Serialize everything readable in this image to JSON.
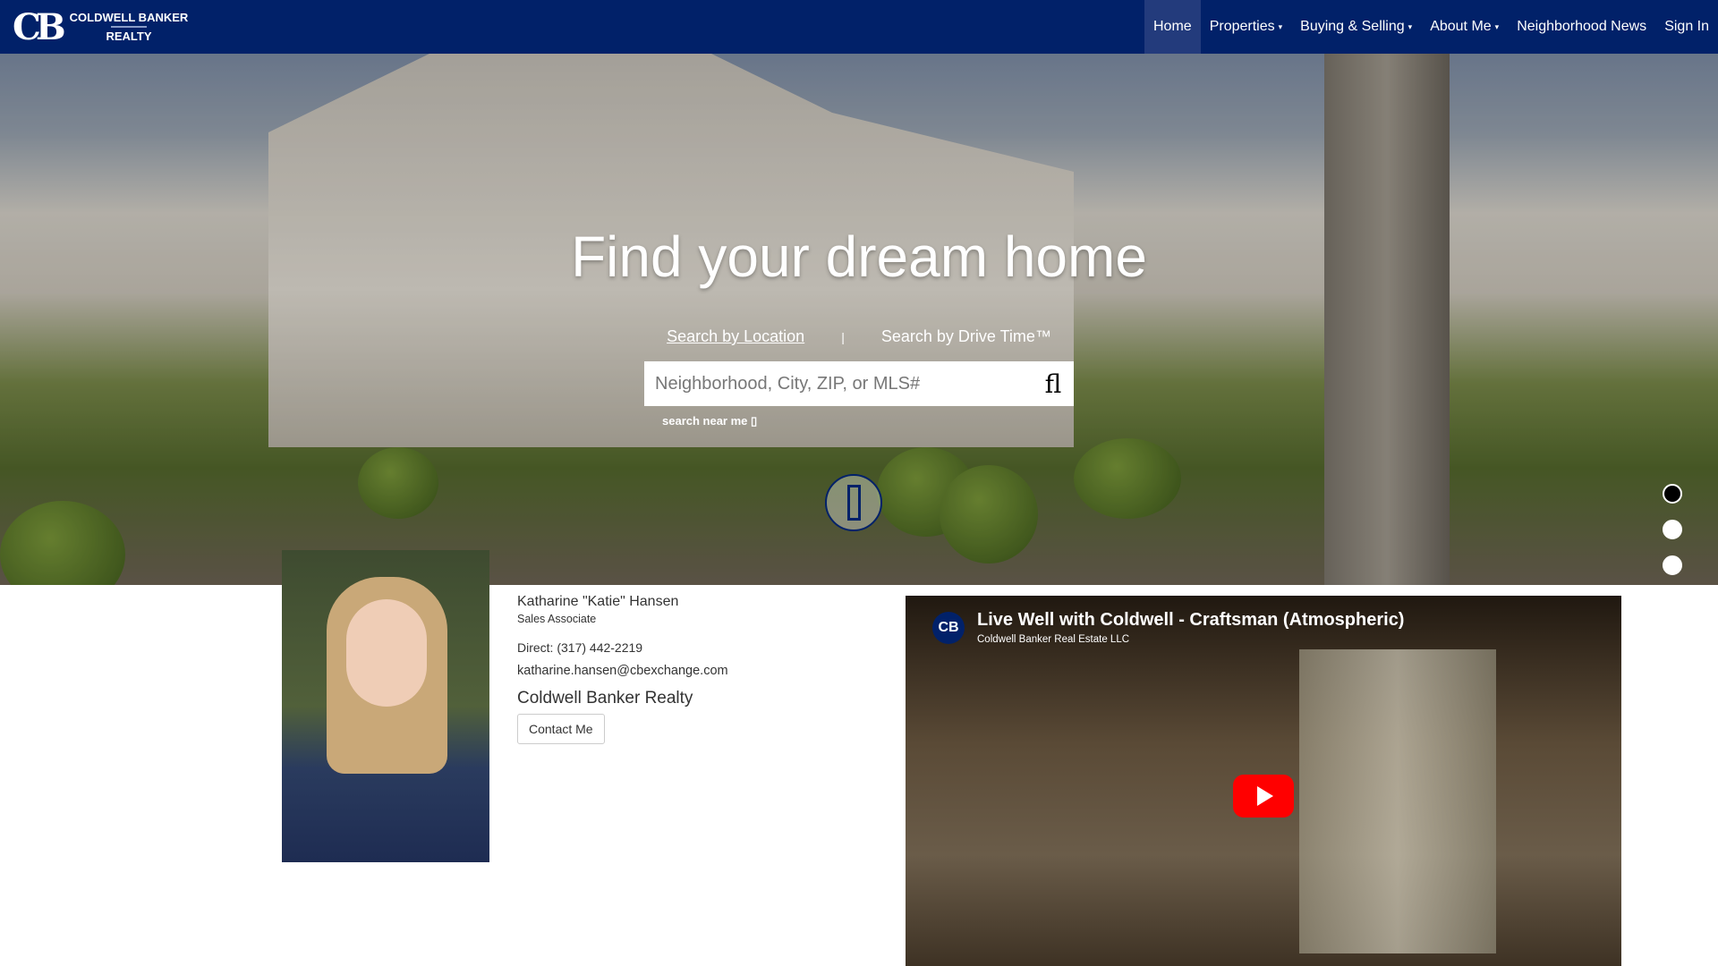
{
  "header": {
    "logo_line1": "COLDWELL BANKER",
    "logo_line2": "REALTY",
    "logo_mark": "CB",
    "nav": [
      {
        "label": "Home"
      },
      {
        "label": "Properties",
        "dropdown": true
      },
      {
        "label": "Buying & Selling",
        "dropdown": true
      },
      {
        "label": "About Me",
        "dropdown": true
      },
      {
        "label": "Neighborhood News"
      },
      {
        "label": "Sign In"
      }
    ],
    "caret": "▾"
  },
  "hero": {
    "title": "Find your dream home",
    "tab_location": "Search by Location",
    "separator": "|",
    "tab_drive": "Search by Drive Time™",
    "search_placeholder": "Neighborhood, City, ZIP, or MLS#",
    "search_icon": "search-icon",
    "search_glyph": "fl",
    "near_me": "search near me ▯",
    "slide_count": 3,
    "active_slide": 1
  },
  "agent": {
    "name": "Katharine \"Katie\" Hansen",
    "title": "Sales Associate",
    "phone": "Direct: (317) 442-2219",
    "email": "katharine.hansen@cbexchange.com",
    "company": "Coldwell Banker Realty",
    "contact_label": "Contact Me"
  },
  "video": {
    "title": "Live Well with Coldwell - Craftsman (Atmospheric)",
    "channel": "Coldwell Banker Real Estate LLC",
    "logo": "CB"
  },
  "colors": {
    "brand": "#012169",
    "play": "#ff0000"
  }
}
